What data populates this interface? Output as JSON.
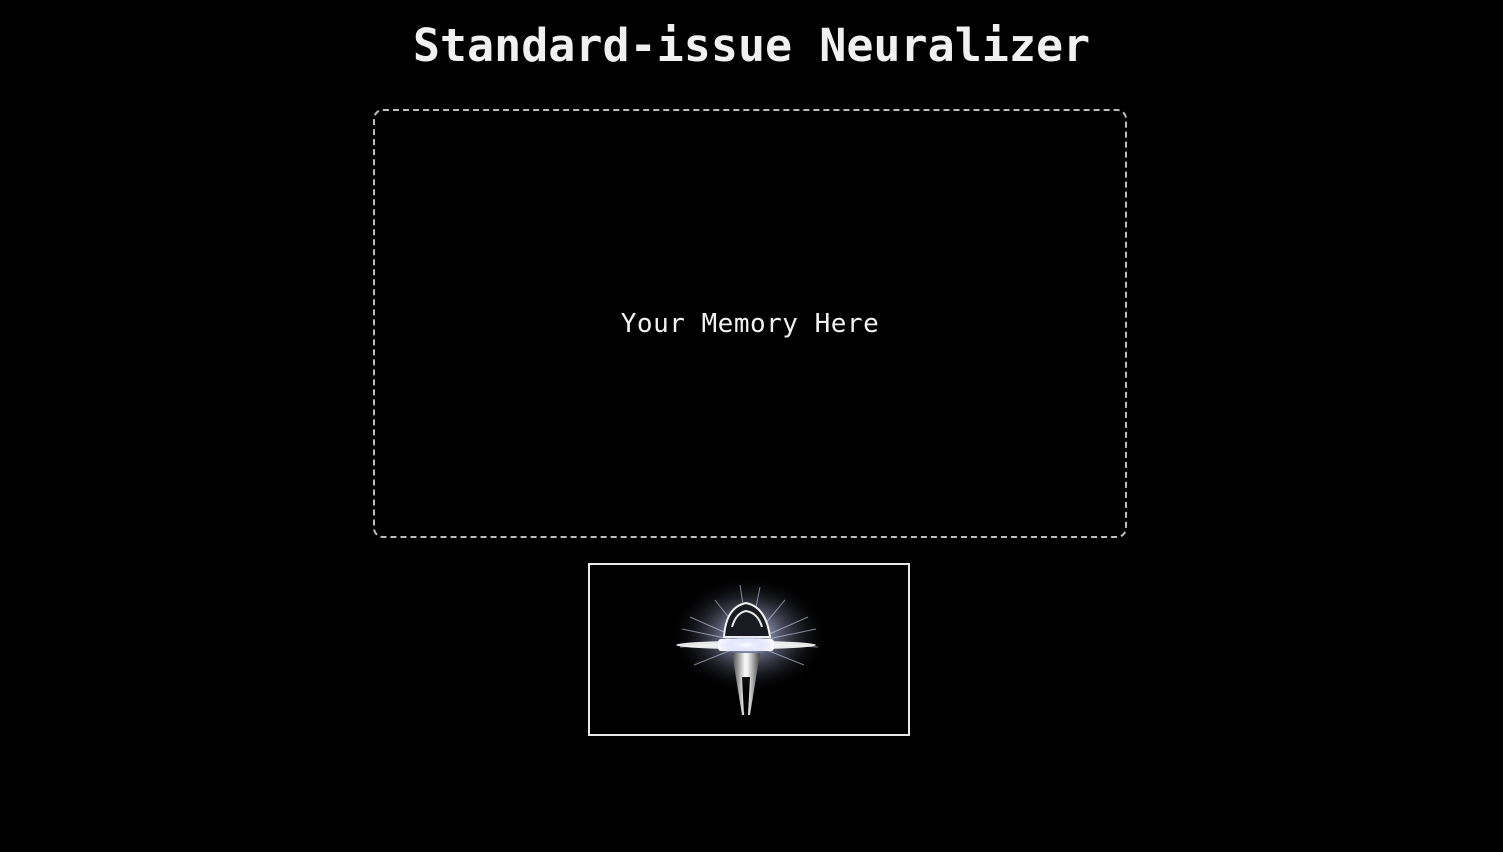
{
  "page": {
    "title": "Standard-issue Neuralizer"
  },
  "memory_zone": {
    "label": "Your Memory Here"
  },
  "neuralizer_button": {
    "icon": "neuralizer-flash-icon"
  },
  "colors": {
    "background": "#000000",
    "text": "#ffffff",
    "dashed_border": "#bdbdbd",
    "button_border": "#e8e8e8",
    "flash_glow": "#c8cfff"
  }
}
